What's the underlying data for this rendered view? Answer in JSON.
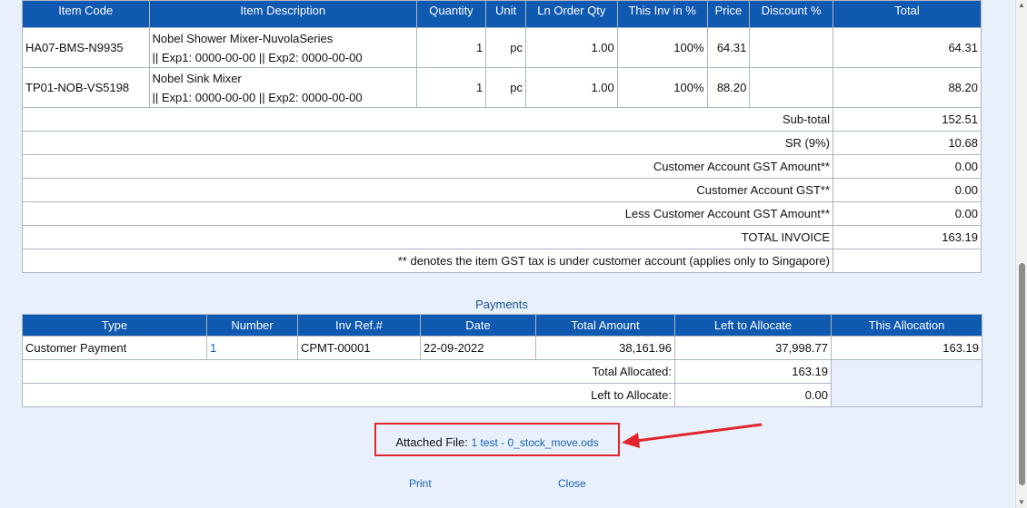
{
  "items_table": {
    "headers": [
      "Item Code",
      "Item Description",
      "Quantity",
      "Unit",
      "Ln Order Qty",
      "This Inv in %",
      "Price",
      "Discount %",
      "Total"
    ],
    "rows": [
      {
        "code": "HA07-BMS-N9935",
        "desc_line1": "Nobel Shower Mixer-NuvolaSeries",
        "desc_line2": "|| Exp1: 0000-00-00 || Exp2: 0000-00-00",
        "quantity": "1",
        "unit": "pc",
        "ln_order_qty": "1.00",
        "inv_pct": "100%",
        "price": "64.31",
        "discount": "",
        "total": "64.31"
      },
      {
        "code": "TP01-NOB-VS5198",
        "desc_line1": "Nobel Sink Mixer",
        "desc_line2": "|| Exp1: 0000-00-00 || Exp2: 0000-00-00",
        "quantity": "1",
        "unit": "pc",
        "ln_order_qty": "1.00",
        "inv_pct": "100%",
        "price": "88.20",
        "discount": "",
        "total": "88.20"
      }
    ],
    "summary": [
      {
        "label": "Sub-total",
        "value": "152.51"
      },
      {
        "label": "SR (9%)",
        "value": "10.68"
      },
      {
        "label": "Customer Account GST Amount**",
        "value": "0.00"
      },
      {
        "label": "Customer Account GST**",
        "value": "0.00"
      },
      {
        "label": "Less Customer Account GST Amount**",
        "value": "0.00"
      },
      {
        "label": "TOTAL INVOICE",
        "value": "163.19"
      }
    ],
    "footnote": "** denotes the item GST tax is under customer account (applies only to Singapore)"
  },
  "payments": {
    "title": "Payments",
    "headers": [
      "Type",
      "Number",
      "Inv Ref.#",
      "Date",
      "Total Amount",
      "Left to Allocate",
      "This Allocation"
    ],
    "rows": [
      {
        "type": "Customer Payment",
        "number": "1",
        "inv_ref": "CPMT-00001",
        "date": "22-09-2022",
        "total_amount": "38,161.96",
        "left_to_allocate": "37,998.77",
        "this_allocation": "163.19"
      }
    ],
    "total_allocated_label": "Total Allocated:",
    "total_allocated_value": "163.19",
    "left_to_allocate_label": "Left to Allocate:",
    "left_to_allocate_value": "0.00"
  },
  "attachment": {
    "label": "Attached File:",
    "file_link": "1 test - 0_stock_move.ods"
  },
  "footer": {
    "print_label": "Print",
    "close_label": "Close"
  },
  "colors": {
    "header_bg": "#0f59b0",
    "page_bg": "#e8f1fb",
    "link": "#1a5fb4",
    "annotation": "#e2252b"
  }
}
